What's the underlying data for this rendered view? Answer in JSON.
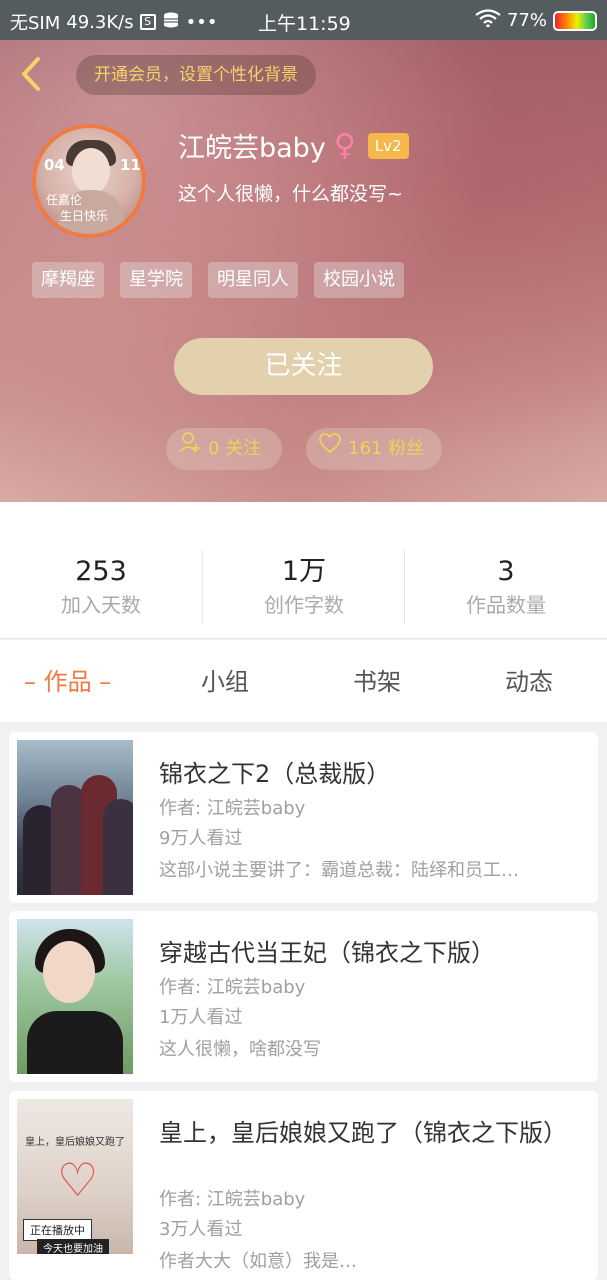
{
  "status_bar": {
    "carrier": "无SIM",
    "speed": "49.3K/s",
    "time": "上午11:59",
    "battery_percent": "77%",
    "icons": [
      "s-box-icon",
      "database-icon",
      "more-dots-icon",
      "wifi-icon",
      "battery-icon"
    ]
  },
  "header": {
    "vip_banner": "开通会员，设置个性化背景",
    "username": "江皖芸baby",
    "level": "Lv2",
    "bio": "这个人很懒，什么都没写~",
    "avatar_text": {
      "left_date": "04",
      "right_date": "11",
      "caption_line1": "任嘉伦",
      "caption_line2": "生日快乐"
    },
    "tags": [
      "摩羯座",
      "星学院",
      "明星同人",
      "校园小说"
    ],
    "follow_button": "已关注",
    "following": "0 关注",
    "fans": "161 粉丝",
    "colors": {
      "accent_orange": "#f07a44",
      "gold": "#f3cf5b",
      "follow_btn": "#e3d0ad"
    }
  },
  "stats": [
    {
      "value": "253",
      "label": "加入天数"
    },
    {
      "value": "1万",
      "label": "创作字数"
    },
    {
      "value": "3",
      "label": "作品数量"
    }
  ],
  "tabs": [
    {
      "label": "– 作品 –",
      "active": true
    },
    {
      "label": "小组",
      "active": false
    },
    {
      "label": "书架",
      "active": false
    },
    {
      "label": "动态",
      "active": false
    }
  ],
  "works": [
    {
      "title": "锦衣之下2（总裁版）",
      "author": "作者: 江皖芸baby",
      "views": "9万人看过",
      "summary": "这部小说主要讲了：霸道总裁：陆绎和员工…"
    },
    {
      "title": "穿越古代当王妃（锦衣之下版）",
      "author": "作者: 江皖芸baby",
      "views": "1万人看过",
      "summary": "这人很懒，啥都没写"
    },
    {
      "title": "皇上，皇后娘娘又跑了（锦衣之下版）",
      "author": "作者: 江皖芸baby",
      "views": "3万人看过",
      "summary": "作者大大（如意）我是…",
      "cover_text": {
        "title": "皇上，皇后娘娘又跑了",
        "playing": "正在播放中",
        "cheer": "今天也要加油"
      }
    }
  ]
}
